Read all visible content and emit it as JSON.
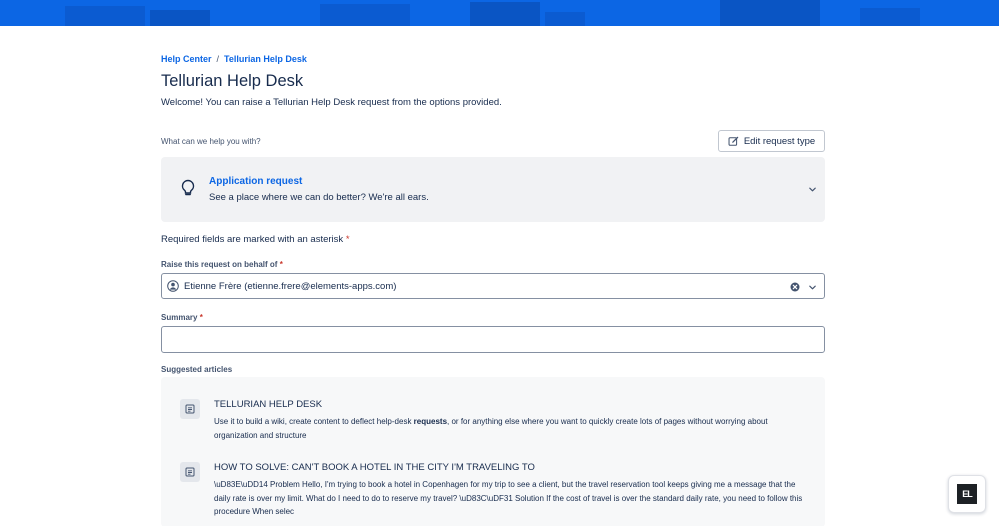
{
  "colors": {
    "brand": "#0c66e4",
    "text": "#172b4d",
    "subtle": "#44546f",
    "asterisk": "#c9372c",
    "card_bg": "#f1f2f4"
  },
  "breadcrumb": {
    "home": "Help Center",
    "separator": "/",
    "current": "Tellurian Help Desk"
  },
  "header": {
    "title": "Tellurian Help Desk",
    "welcome": "Welcome! You can raise a Tellurian Help Desk request from the options provided."
  },
  "request_type": {
    "section_label": "What can we help you with?",
    "edit_button_label": "Edit request type",
    "edit_icon": "edit-icon",
    "selected_title": "Application request",
    "selected_description": "See a place where we can do better? We're all ears.",
    "icon": "lightbulb-icon"
  },
  "form": {
    "required_note": "Required fields are marked with an asterisk",
    "asterisk": "*",
    "behalf": {
      "label": "Raise this request on behalf of",
      "value": "Etienne Frère (etienne.frere@elements-apps.com)"
    },
    "summary": {
      "label": "Summary",
      "value": "",
      "placeholder": ""
    }
  },
  "suggested": {
    "label": "Suggested articles",
    "articles": [
      {
        "title": "TELLURIAN HELP DESK",
        "body_before": "Use it to build a wiki, create content to deflect help-desk ",
        "body_bold": "requests",
        "body_after": ", or for anything else where you want to quickly create lots of pages without worrying about organization and structure"
      },
      {
        "title": "HOW TO SOLVE: CAN'T BOOK A HOTEL IN THE CITY I'M TRAVELING TO",
        "body": "\\uD83E\\uDD14  Problem Hello, I'm trying to book a hotel in Copenhagen for my trip to see a client, but the travel reservation tool keeps giving me a message that the daily rate is over my limit. What do I need to do to reserve my travel? \\uD83C\\uDF31  Solution If the cost of travel is over the standard daily rate, you need to follow this procedure When selec"
      }
    ]
  },
  "fab": {
    "logo_text": "EL"
  }
}
